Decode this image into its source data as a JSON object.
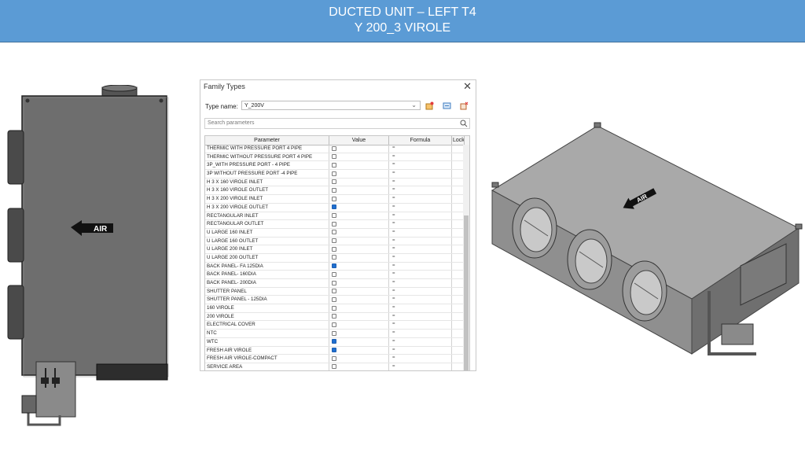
{
  "header": {
    "title_line1": "DUCTED UNIT – LEFT  T4",
    "title_line2": "Y 200_3 VIROLE"
  },
  "left_drawing": {
    "arrow_label": "AIR"
  },
  "iso_drawing": {
    "arrow_label": "AIR"
  },
  "dialog": {
    "title": "Family Types",
    "close_icon": "close-icon",
    "type_name_label": "Type name:",
    "type_name_value": "Y_200V",
    "search_placeholder": "Search parameters",
    "columns": [
      "Parameter",
      "Value",
      "Formula",
      "Lock"
    ],
    "rows": [
      {
        "parameter": "THERMIC WITH PRESSURE PORT 4 PIPE",
        "checked": false,
        "formula": "="
      },
      {
        "parameter": "THERMIC WITHOUT PRESSURE PORT  4 PIPE",
        "checked": false,
        "formula": "="
      },
      {
        "parameter": "3P_WITH PRESSURE PORT - 4 PIPE",
        "checked": false,
        "formula": "="
      },
      {
        "parameter": "3P WITHOUT PRESSURE PORT -4  PIPE",
        "checked": false,
        "formula": "="
      },
      {
        "parameter": "H  3 X 160 VIROLE INLET",
        "checked": false,
        "formula": "="
      },
      {
        "parameter": "H  3 X 160 VIROLE OUTLET",
        "checked": false,
        "formula": "="
      },
      {
        "parameter": "H  3 X 200 VIROLE INLET",
        "checked": false,
        "formula": "="
      },
      {
        "parameter": "H  3 X 200 VIROLE OUTLET",
        "checked": true,
        "formula": "="
      },
      {
        "parameter": "RECTANGULAR INLET",
        "checked": false,
        "formula": "="
      },
      {
        "parameter": "RECTANGULAR OUTLET",
        "checked": false,
        "formula": "="
      },
      {
        "parameter": "U LARGE 160 INLET",
        "checked": false,
        "formula": "="
      },
      {
        "parameter": "U LARGE 160 OUTLET",
        "checked": false,
        "formula": "="
      },
      {
        "parameter": "U LARGE 200 INLET",
        "checked": false,
        "formula": "="
      },
      {
        "parameter": "U LARGE 200 OUTLET",
        "checked": false,
        "formula": "="
      },
      {
        "parameter": "BACK PANEL- FA 125DIA",
        "checked": true,
        "formula": "="
      },
      {
        "parameter": "BACK PANEL- 160DIA",
        "checked": false,
        "formula": "="
      },
      {
        "parameter": "BACK PANEL- 200DIA",
        "checked": false,
        "formula": "="
      },
      {
        "parameter": "SHUTTER PANEL",
        "checked": false,
        "formula": "="
      },
      {
        "parameter": "SHUTTER PANEL - 125DIA",
        "checked": false,
        "formula": "="
      },
      {
        "parameter": "160 VIROLE",
        "checked": false,
        "formula": "="
      },
      {
        "parameter": "200 VIROLE",
        "checked": false,
        "formula": "="
      },
      {
        "parameter": "ELECTRICAL COVER",
        "checked": false,
        "formula": "="
      },
      {
        "parameter": "NTC",
        "checked": false,
        "formula": "="
      },
      {
        "parameter": "WTC",
        "checked": true,
        "formula": "="
      },
      {
        "parameter": "FRESH AIR VIROLE",
        "checked": true,
        "formula": "="
      },
      {
        "parameter": "FRESH AIR VIROLE-COMPACT",
        "checked": false,
        "formula": "="
      },
      {
        "parameter": "SERVICE AREA",
        "checked": false,
        "formula": "="
      }
    ]
  }
}
